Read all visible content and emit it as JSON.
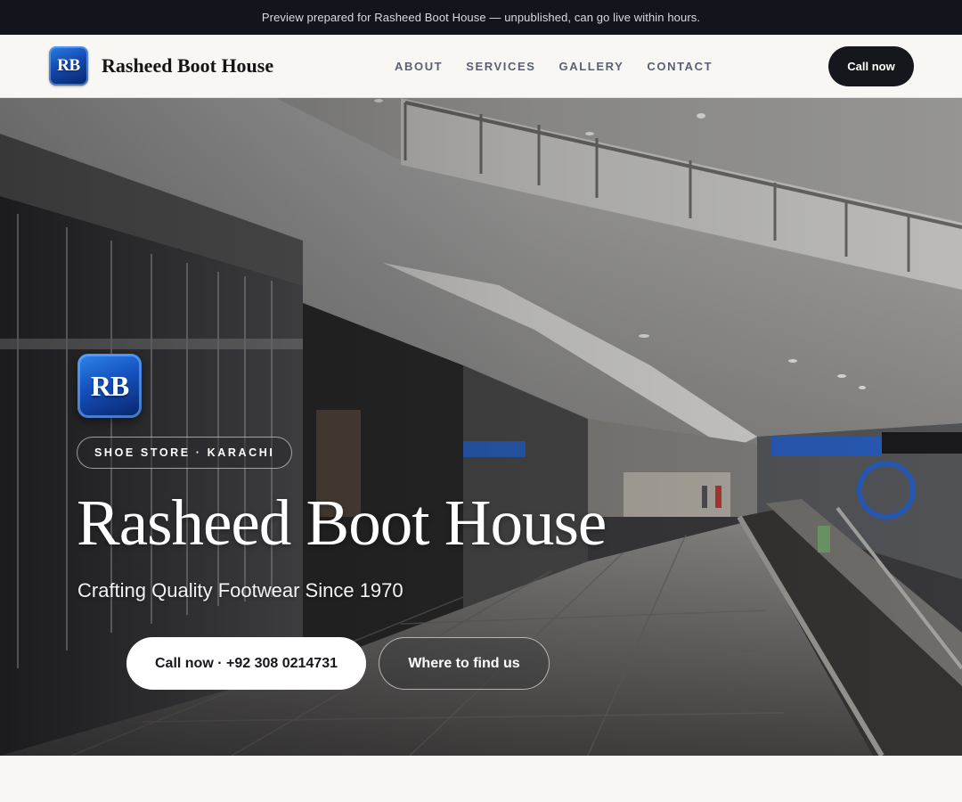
{
  "banner": {
    "text": "Preview prepared for Rasheed Boot House — unpublished, can go live within hours."
  },
  "header": {
    "logo_initials": "RB",
    "brand_name": "Rasheed Boot House",
    "nav": [
      {
        "label": "ABOUT"
      },
      {
        "label": "SERVICES"
      },
      {
        "label": "GALLERY"
      },
      {
        "label": "CONTACT"
      }
    ],
    "cta_label": "Call now"
  },
  "hero": {
    "logo_initials": "RB",
    "category": "SHOE STORE · KARACHI",
    "title": "Rasheed Boot House",
    "tagline": "Crafting Quality Footwear Since 1970",
    "primary_button": "Call now · +92 308 0214731",
    "secondary_button": "Where to find us",
    "background_image": "shopping-mall-interior-photo"
  },
  "colors": {
    "banner_bg": "#12151b",
    "header_bg": "#f8f7f4",
    "cta_bg": "#15171c",
    "logo_blue": "#1349b1",
    "nav_text": "#5b6070"
  }
}
